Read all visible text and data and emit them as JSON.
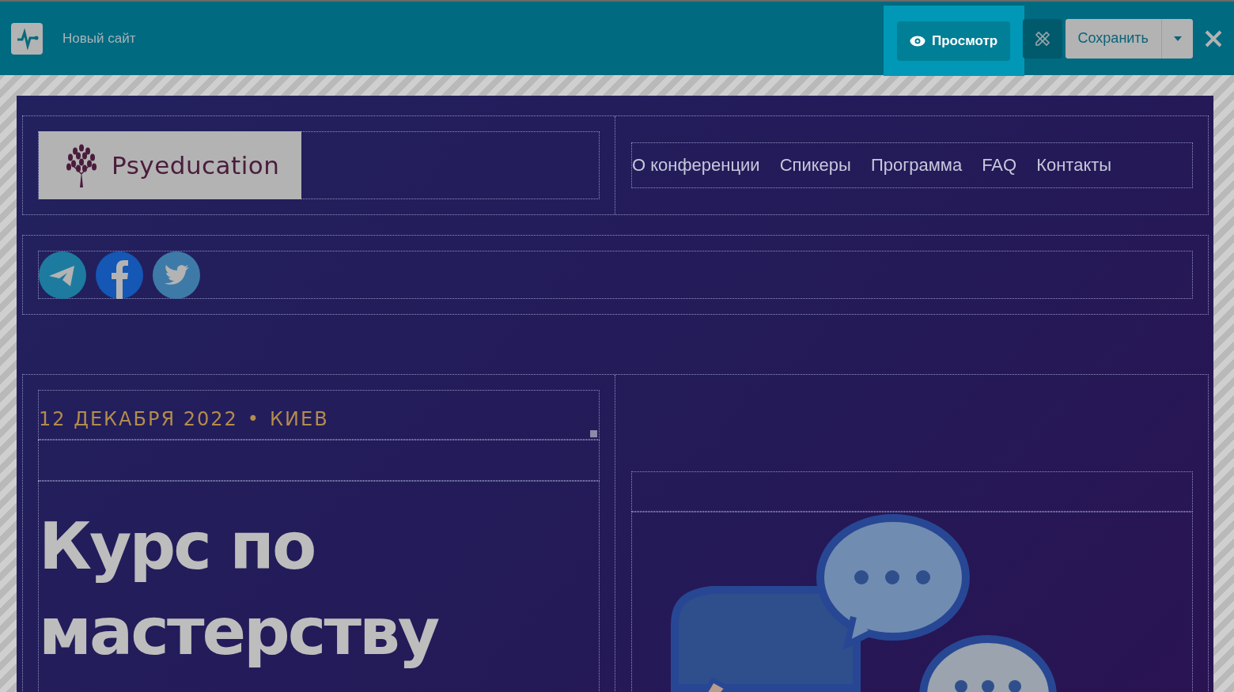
{
  "topbar": {
    "site_title": "Новый сайт",
    "preview": {
      "label": "Просмотр",
      "active": true
    },
    "save": {
      "label": "Сохранить"
    }
  },
  "header": {
    "logo_text": "Psyeducation",
    "nav": [
      "О конференции",
      "Спикеры",
      "Программа",
      "FAQ",
      "Контакты"
    ]
  },
  "social": [
    {
      "kind": "telegram"
    },
    {
      "kind": "facebook"
    },
    {
      "kind": "twitter"
    }
  ],
  "hero": {
    "date": "12 ДЕКАБРЯ 2022",
    "separator": "•",
    "city": "КИЕВ",
    "headline": "Курс по мастерству"
  }
}
